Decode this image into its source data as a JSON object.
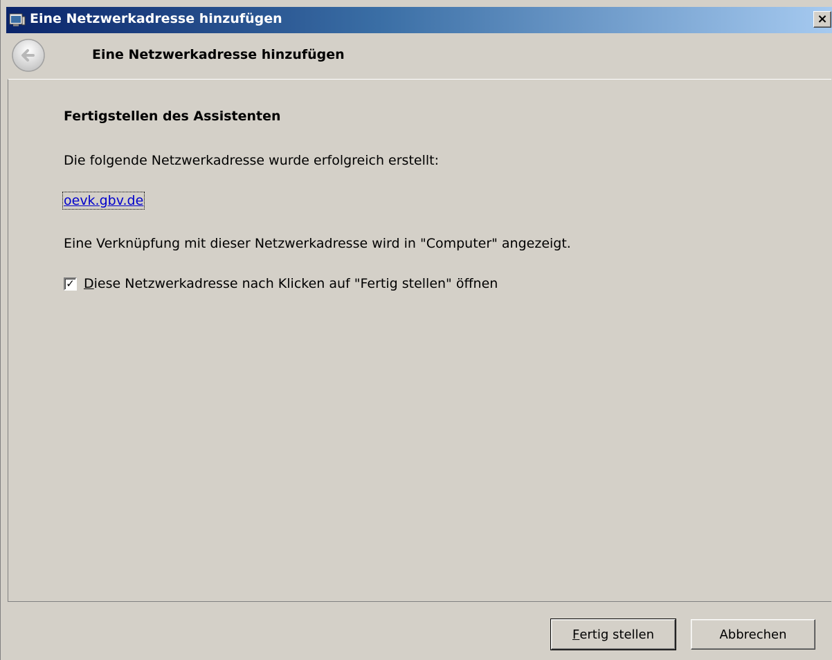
{
  "window": {
    "title": "Eine Netzwerkadresse hinzufügen",
    "close_label": "×"
  },
  "header": {
    "title": "Eine Netzwerkadresse hinzufügen"
  },
  "main": {
    "heading": "Fertigstellen des Assistenten",
    "intro_text": "Die folgende Netzwerkadresse wurde erfolgreich erstellt:",
    "network_address_link": "oevk.gbv.de",
    "shortcut_text": "Eine Verknüpfung mit dieser Netzwerkadresse wird in \"Computer\" angezeigt.",
    "open_checkbox": {
      "checked": true,
      "label_first": "D",
      "label_rest": "iese Netzwerkadresse nach Klicken auf \"Fertig stellen\" öffnen"
    }
  },
  "footer": {
    "finish_first": "F",
    "finish_rest": "ertig stellen",
    "cancel_label": "Abbrechen"
  },
  "colors": {
    "titlebar_start": "#0a246a",
    "titlebar_end": "#a6caf0",
    "window_bg": "#d4d0c8",
    "link": "#0000cc"
  }
}
